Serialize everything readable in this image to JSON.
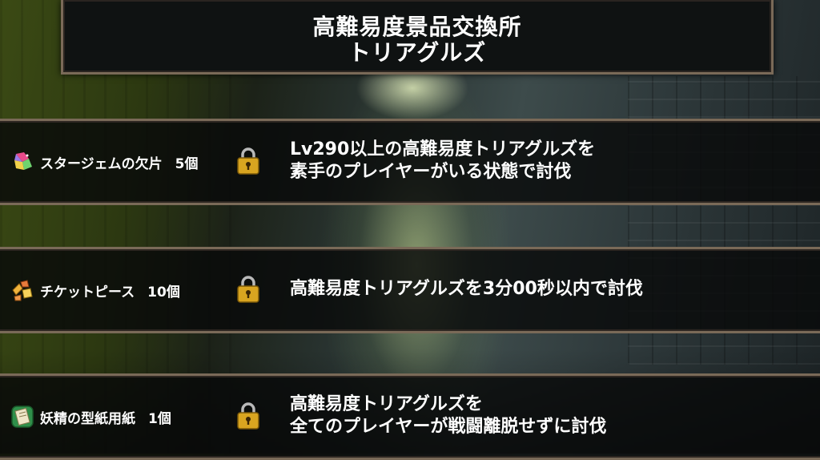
{
  "header": {
    "title": "高難易度景品交換所",
    "subtitle": "トリアグルズ"
  },
  "rewards": [
    {
      "name": "スタージェムの欠片",
      "count": "5個",
      "icon": "star-gem-shard-icon",
      "condition_lines": [
        "Lv290以上の高難易度トリアグルズを",
        "素手のプレイヤーがいる状態で討伐"
      ]
    },
    {
      "name": "チケットピース",
      "count": "10個",
      "icon": "ticket-piece-icon",
      "condition_lines": [
        "高難易度トリアグルズを3分00秒以内で討伐"
      ]
    },
    {
      "name": "妖精の型紙用紙",
      "count": "1個",
      "icon": "fairy-pattern-paper-icon",
      "condition_lines": [
        "高難易度トリアグルズを",
        "全てのプレイヤーが戦闘離脱せずに討伐"
      ]
    }
  ],
  "colors": {
    "frame": "#7a6a58",
    "panel": "#0f1212",
    "lock_gold": "#d9a520"
  }
}
